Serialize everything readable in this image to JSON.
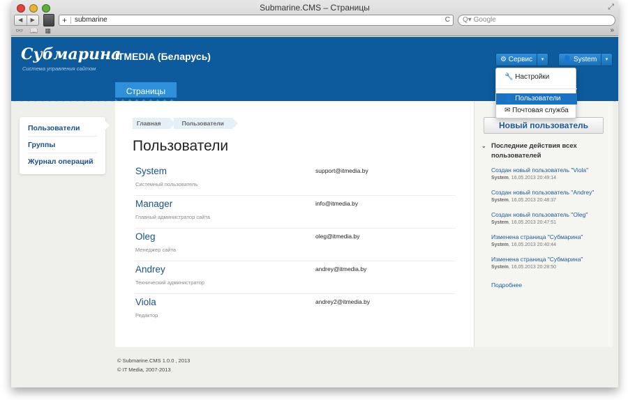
{
  "browser": {
    "window_title": "Submarine.CMS – Страницы",
    "url": "submarine",
    "search_placeholder": "Google",
    "back_glyph": "◀",
    "forward_glyph": "▶",
    "plus_glyph": "+",
    "reload_glyph": "C",
    "search_glyph": "Q▾",
    "bookmarks": [
      "👓",
      "📖",
      "▦"
    ],
    "more_glyph": "»",
    "resize_glyph": "⤢"
  },
  "header": {
    "logo_title": "Субмарина",
    "logo_subtitle": "Система управления сайтом",
    "site_name": "ITMEDIA (Беларусь)",
    "service_button": "Сервис",
    "service_icon": "⚙",
    "user_button": "System",
    "user_icon": "👤",
    "caret": "▾",
    "tab_pages": "Страницы"
  },
  "dropdown": {
    "items": [
      {
        "label": "Настройки",
        "icon": "🔧"
      },
      {
        "label": "Пользователи",
        "icon": "👤"
      },
      {
        "label": "Почтовая служба",
        "icon": "✉"
      }
    ]
  },
  "sidebar": {
    "items": [
      "Пользователи",
      "Группы",
      "Журнал операций"
    ]
  },
  "main": {
    "breadcrumb": [
      "Главная",
      "Пользователи"
    ],
    "title": "Пользователи",
    "users": [
      {
        "name": "System",
        "role": "Системный пользователь",
        "email": "support@itmedia.by"
      },
      {
        "name": "Manager",
        "role": "Главный администратор сайта",
        "email": "info@itmedia.by"
      },
      {
        "name": "Oleg",
        "role": "Менеджер сайта",
        "email": "oleg@itmedia.by"
      },
      {
        "name": "Andrey",
        "role": "Технический администратор",
        "email": "andrey@itmedia.by"
      },
      {
        "name": "Viola",
        "role": "Редактор",
        "email": "andrey2@itmedia.by"
      }
    ]
  },
  "right": {
    "new_user_button": "Новый пользователь",
    "actions_heading": "Последние действия всех пользователей",
    "chevron": "⌄",
    "actions": [
      {
        "text": "Создан новый пользователь \"Viola\"",
        "author": "System",
        "date": ", 16.05.2013 20:49:14"
      },
      {
        "text": "Создан новый пользователь \"Andrey\"",
        "author": "System",
        "date": ", 16.05.2013 20:48:37"
      },
      {
        "text": "Создан новый пользователь \"Oleg\"",
        "author": "System",
        "date": ", 16.05.2013 20:47:51"
      },
      {
        "text": "Изменена страница \"Субмарина\"",
        "author": "System",
        "date": ", 16.05.2013 20:40:44"
      },
      {
        "text": "Изменена страница \"Субмарина\"",
        "author": "System",
        "date": ", 16.05.2013 20:28:50"
      }
    ],
    "more_link": "Подробнее"
  },
  "footer": {
    "line1": "© Submarine.CMS 1.0.0 , 2013",
    "line2": "© IT Media, 2007-2013"
  }
}
